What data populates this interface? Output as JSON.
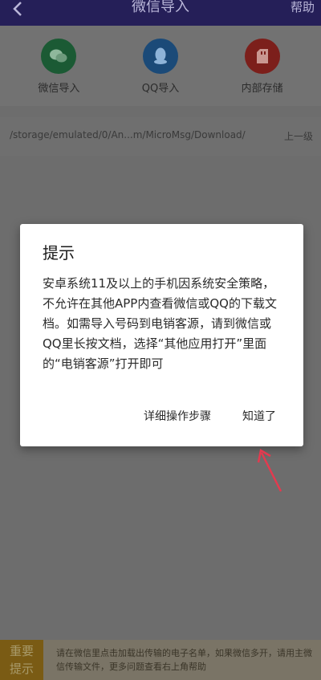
{
  "header": {
    "title": "微信导入",
    "help_label": "帮助",
    "back_icon": "chevron-left-icon"
  },
  "sources": [
    {
      "label": "微信导入",
      "icon": "wechat-icon",
      "color": "#1b5a34"
    },
    {
      "label": "QQ导入",
      "icon": "qq-icon",
      "color": "#1b4a78"
    },
    {
      "label": "内部存储",
      "icon": "sd-card-icon",
      "color": "#7c1f1b"
    }
  ],
  "pathbar": {
    "path": "/storage/emulated/0/An...m/MicroMsg/Download/",
    "up_label": "上一级"
  },
  "dialog": {
    "title": "提示",
    "message": "安卓系统11及以上的手机因系统安全策略，不允许在其他APP内查看微信或QQ的下载文档。如需导入号码到电销客源，请到微信或QQ里长按文档，选择“其他应用打开”里面的“电销客源”打开即可",
    "steps_button": "详细操作步骤",
    "ok_button": "知道了"
  },
  "tip": {
    "badge": "重要\n提示",
    "text": "请在微信里点击加载出传输的电子名单，如果微信多开，请用主微信传输文件，更多问题查看右上角帮助"
  },
  "colors": {
    "header_bg": "#251f58",
    "overlay": "#6d6d6d",
    "arrow": "#e33a4f"
  }
}
